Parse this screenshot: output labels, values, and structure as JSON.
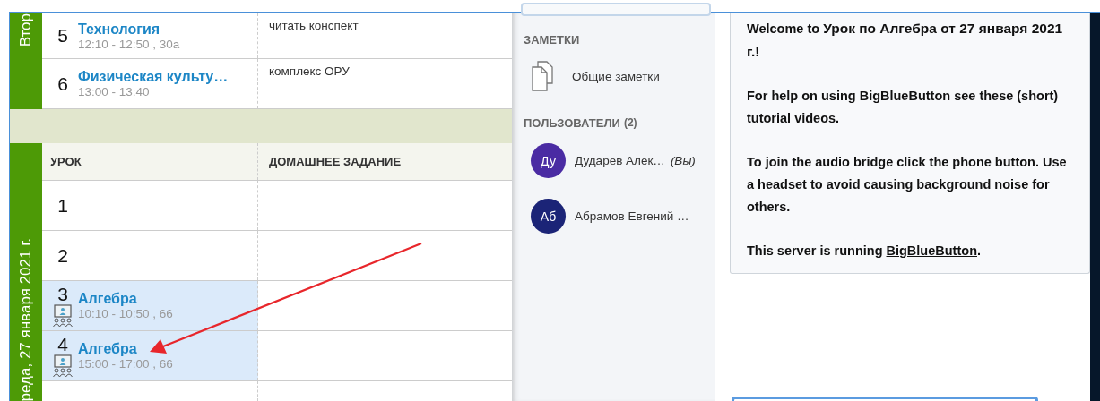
{
  "schedule": {
    "days": [
      {
        "label": "Втор",
        "lessons": [
          {
            "number": "5",
            "subject": "Технология",
            "details": "12:10 - 12:50 , 30а",
            "homework": "читать конспект",
            "online": false,
            "selected": false
          },
          {
            "number": "6",
            "subject": "Физическая культу…",
            "details": "13:00 - 13:40",
            "homework": "комплекс ОРУ",
            "online": false,
            "selected": false
          }
        ]
      },
      {
        "label": "реда, 27 января 2021 г.",
        "columns": [
          "УРОК",
          "ДОМАШНЕЕ ЗАДАНИЕ"
        ],
        "lessons": [
          {
            "number": "1",
            "online": false,
            "selected": false
          },
          {
            "number": "2",
            "online": false,
            "selected": false
          },
          {
            "number": "3",
            "subject": "Алгебра",
            "details": "10:10 - 10:50 , 66",
            "online": true,
            "selected": true
          },
          {
            "number": "4",
            "subject": "Алгебра",
            "details": "15:00 - 17:00 , 66",
            "online": true,
            "selected": true
          }
        ]
      }
    ]
  },
  "sidebar": {
    "notes_heading": "ЗАМЕТКИ",
    "notes": [
      {
        "label": "Общие заметки"
      }
    ],
    "users_heading": "ПОЛЬЗОВАТЕЛИ",
    "users_count": "(2)",
    "users": [
      {
        "initials": "Ду",
        "name": "Дударев Алек…",
        "you_label": "(Вы)",
        "color": "#4a2ba3"
      },
      {
        "initials": "Аб",
        "name": "Абрамов Евгений …",
        "color": "#1b2477"
      }
    ]
  },
  "chat": {
    "welcome": [
      [
        {
          "kind": "text",
          "text": "Welcome to "
        },
        {
          "kind": "bold",
          "text": "Урок по Алгебра от 27 января 2021 г."
        },
        {
          "kind": "text",
          "text": "!"
        }
      ],
      [
        {
          "kind": "text",
          "text": "For help on using BigBlueButton see these (short) "
        },
        {
          "kind": "link",
          "text": "tutorial videos"
        },
        {
          "kind": "text",
          "text": "."
        }
      ],
      [
        {
          "kind": "text",
          "text": "To join the audio bridge click the phone button. Use a headset to avoid causing background noise for others."
        }
      ],
      [
        {
          "kind": "text",
          "text": "This server is running "
        },
        {
          "kind": "link",
          "text": "BigBlueButton"
        },
        {
          "kind": "text",
          "text": "."
        }
      ]
    ]
  }
}
